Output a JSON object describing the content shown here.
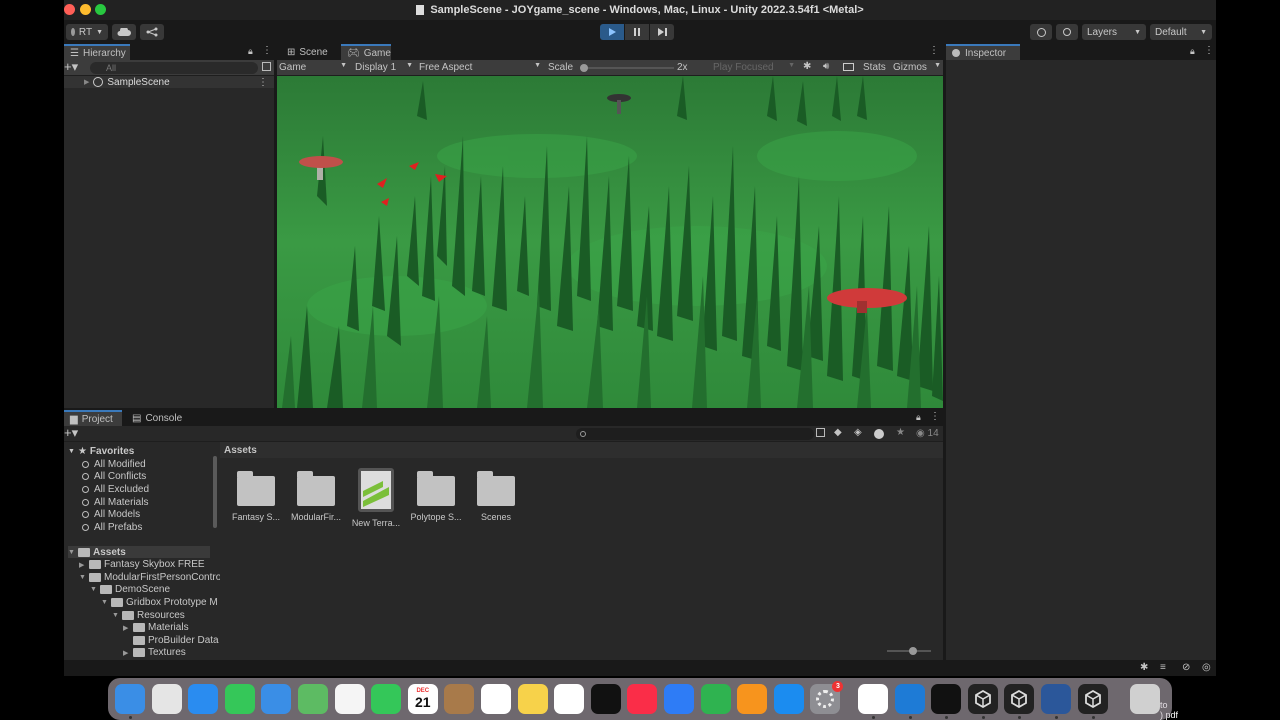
{
  "window": {
    "title": "SampleScene - JOYgame_scene - Windows, Mac, Linux - Unity 2022.3.54f1 <Metal>"
  },
  "toolbar": {
    "account": "RT",
    "layers": "Layers",
    "layout": "Default"
  },
  "hierarchy": {
    "tab": "Hierarchy",
    "search_placeholder": "All",
    "scene": "SampleScene"
  },
  "view_tabs": {
    "scene": "Scene",
    "game": "Game"
  },
  "game_bar": {
    "mode": "Game",
    "display": "Display 1",
    "aspect": "Free Aspect",
    "scale_label": "Scale",
    "scale_value": "2x",
    "play_focused": "Play Focused",
    "stats": "Stats",
    "gizmos": "Gizmos"
  },
  "inspector": {
    "tab": "Inspector"
  },
  "bottom_tabs": {
    "project": "Project",
    "console": "Console"
  },
  "project": {
    "badge_count": "14",
    "favorites_header": "Favorites",
    "favorites": [
      "All Modified",
      "All Conflicts",
      "All Excluded",
      "All Materials",
      "All Models",
      "All Prefabs"
    ],
    "assets_header": "Assets",
    "tree": [
      {
        "label": "Assets",
        "depth": 0,
        "expanded": true
      },
      {
        "label": "Fantasy Skybox FREE",
        "depth": 1,
        "expanded": false
      },
      {
        "label": "ModularFirstPersonContro",
        "depth": 1,
        "expanded": true
      },
      {
        "label": "DemoScene",
        "depth": 2,
        "expanded": true
      },
      {
        "label": "Gridbox Prototype M",
        "depth": 3,
        "expanded": true
      },
      {
        "label": "Resources",
        "depth": 4,
        "expanded": true
      },
      {
        "label": "Materials",
        "depth": 5,
        "expanded": false
      },
      {
        "label": "ProBuilder Data",
        "depth": 5,
        "expanded": null
      },
      {
        "label": "Textures",
        "depth": 5,
        "expanded": false
      }
    ],
    "breadcrumb": "Assets",
    "assets": [
      {
        "label": "Fantasy S...",
        "kind": "folder"
      },
      {
        "label": "ModularFir...",
        "kind": "folder"
      },
      {
        "label": "New Terra...",
        "kind": "terrain"
      },
      {
        "label": "Polytope S...",
        "kind": "folder"
      },
      {
        "label": "Scenes",
        "kind": "folder"
      }
    ]
  },
  "dock": {
    "calendar_month": "DEC",
    "calendar_day": "21",
    "settings_badge": "3",
    "apps": [
      "finder-icon",
      "launchpad-icon",
      "safari-icon",
      "messages-icon",
      "mail-icon",
      "maps-icon",
      "photos-icon",
      "facetime-icon",
      "calendar-icon",
      "contacts-icon",
      "reminders-icon",
      "notes-icon",
      "freeform-icon",
      "appletv-icon",
      "music-icon",
      "keynote-icon",
      "numbers-icon",
      "pages-icon",
      "appstore-icon",
      "settings-icon",
      "chrome-icon",
      "vscode-icon",
      "terminal-icon",
      "unity-hub-icon",
      "unity-icon",
      "word-icon",
      "unity-editor-icon",
      "trash-icon"
    ]
  },
  "desktop_file": {
    "line1": "to",
    "line2": ") pdf"
  },
  "colors": {
    "editor_bg": "#191919",
    "panel_bg": "#282828",
    "accent_blue": "#3a79bb",
    "grass": "#2f8a3a"
  }
}
